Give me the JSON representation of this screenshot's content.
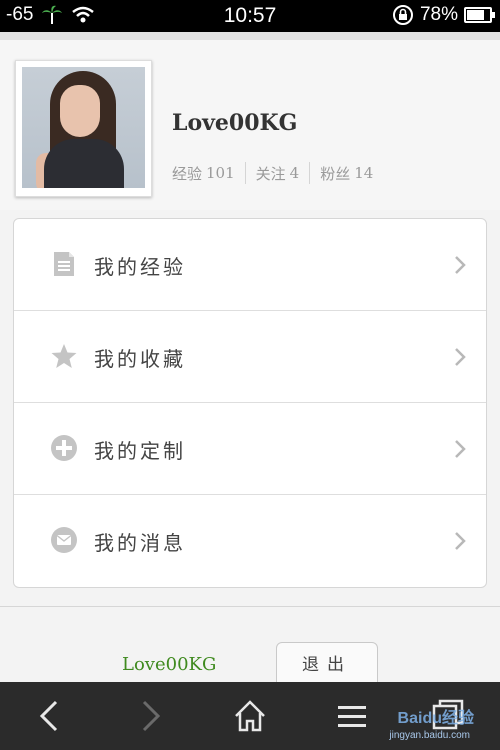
{
  "status_bar": {
    "signal": "-65",
    "time": "10:57",
    "battery": "78%",
    "battery_level": 0.78
  },
  "profile": {
    "username": "Love00KG",
    "stats": [
      {
        "label": "经验",
        "value": "101"
      },
      {
        "label": "关注",
        "value": "4"
      },
      {
        "label": "粉丝",
        "value": "14"
      }
    ]
  },
  "menu": {
    "items": [
      {
        "label": "我的经验",
        "icon": "document-icon"
      },
      {
        "label": "我的收藏",
        "icon": "star-icon"
      },
      {
        "label": "我的定制",
        "icon": "plus-circle-icon"
      },
      {
        "label": "我的消息",
        "icon": "envelope-icon"
      }
    ]
  },
  "footer": {
    "username": "Love00KG",
    "logout_label": "退出"
  },
  "watermark": {
    "text": "Baidu经验",
    "url": "jingyan.baidu.com"
  },
  "colors": {
    "status_bar_bg": "#000000",
    "footer_username": "#3f8a1f",
    "nav_bg": "#2b2b2b"
  }
}
